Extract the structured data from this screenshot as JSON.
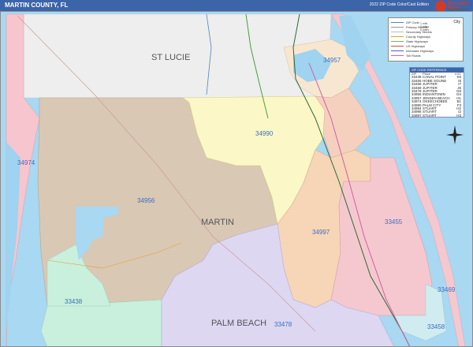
{
  "header": {
    "title": "MARTIN COUNTY, FL",
    "edition": "2022 ZIP Code Color/Cast Edition"
  },
  "logo": {
    "brand": "Marshall Maps",
    "sub": "mapsales.com"
  },
  "legend": {
    "city_label": "City",
    "rows": [
      {
        "label": "ZIP Code",
        "color": "#5a7fc0"
      },
      {
        "label": "Primary Streets",
        "color": "#999999"
      },
      {
        "label": "Secondary Streets",
        "color": "#bbbbbb"
      },
      {
        "label": "County Highways",
        "color": "#e0a030"
      },
      {
        "label": "State Highways",
        "color": "#7fb04f"
      },
      {
        "label": "US Highways",
        "color": "#c05050"
      },
      {
        "label": "Interstate Highways",
        "color": "#4060c0"
      },
      {
        "label": "Toll Roads",
        "color": "#d060a0"
      }
    ],
    "scale_rows": [
      "1 mile",
      "2 miles",
      "5 miles"
    ]
  },
  "zip_table": {
    "header": "ZIP CODE REFERENCE",
    "columns": [
      "ZIP",
      "Place",
      "LOC"
    ],
    "rows": [
      [
        "33438",
        "CANAL POINT",
        "K6"
      ],
      [
        "33455",
        "HOBE SOUND",
        "I5"
      ],
      [
        "33458",
        "JUPITER",
        "I7"
      ],
      [
        "33469",
        "JUPITER",
        "J6"
      ],
      [
        "33478",
        "JUPITER",
        "G8"
      ],
      [
        "34956",
        "INDIANTOWN",
        "D4"
      ],
      [
        "34957",
        "JENSEN BEACH",
        "H1"
      ],
      [
        "34974",
        "OKEECHOBEE",
        "B1"
      ],
      [
        "34990",
        "PALM CITY",
        "F3"
      ],
      [
        "34994",
        "STUART",
        "H2"
      ],
      [
        "34996",
        "STUART",
        "I2"
      ],
      [
        "34997",
        "STUART",
        "H3"
      ]
    ]
  },
  "counties": {
    "st_lucie": "ST LUCIE",
    "martin": "MARTIN",
    "palm_beach": "PALM BEACH"
  },
  "zips": {
    "z34957": "34957",
    "z34990": "34990",
    "z34974": "34974",
    "z34956": "34956",
    "z34997": "34997",
    "z33455": "33455",
    "z33438": "33438",
    "z33478": "33478",
    "z33469": "33469",
    "z33458": "33458"
  },
  "colors": {
    "water": "#a8d8f2",
    "st_lucie": "#f0f0f0",
    "z34956": "#d9c8b4",
    "z34990": "#fbf7c6",
    "z34997": "#f7d5b7",
    "z33455": "#f5c8cf",
    "z34974": "#f7c5ce",
    "z33438": "#c8f0dc",
    "z33478": "#ddd7f2",
    "header": "#3c64a8"
  }
}
